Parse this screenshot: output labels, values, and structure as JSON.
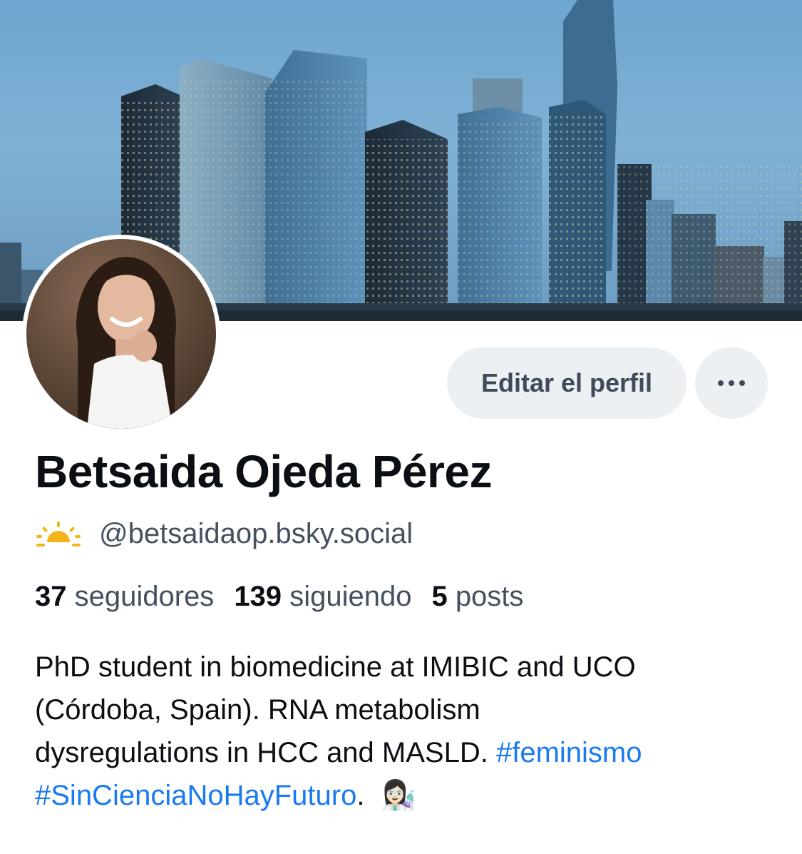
{
  "profile": {
    "edit_label": "Editar el perfil",
    "name": "Betsaida Ojeda Pérez",
    "handle": "@betsaidaop.bsky.social",
    "stats": [
      {
        "count": "37",
        "label": "seguidores"
      },
      {
        "count": "139",
        "label": "siguiendo"
      },
      {
        "count": "5",
        "label": "posts"
      }
    ],
    "bio": {
      "line1": "PhD student in biomedicine at IMIBIC and UCO",
      "line2": "(Córdoba, Spain). RNA metabolism",
      "line3_text": "dysregulations in HCC and MASLD.",
      "tag1": "#feminismo",
      "tag2": "#SinCienciaNoHayFuturo",
      "after_tag2": ".",
      "emoji": "👩🏻‍🔬"
    }
  },
  "icons": {
    "handle_emoji": "sunrise-icon",
    "more": "ellipsis-icon"
  },
  "colors": {
    "link": "#1a7af0",
    "button_bg": "#edf0f3",
    "text_primary": "#0b0f14",
    "text_secondary": "#45505f"
  }
}
